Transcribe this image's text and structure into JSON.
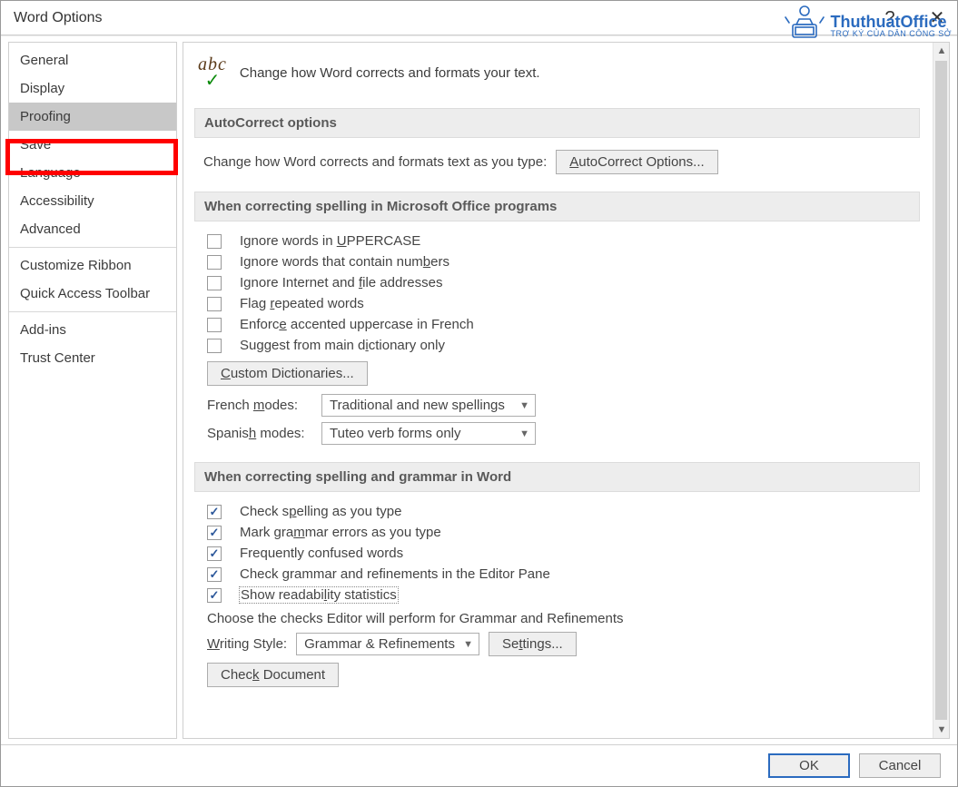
{
  "title": "Word Options",
  "sidebar": {
    "items": [
      {
        "label": "General"
      },
      {
        "label": "Display"
      },
      {
        "label": "Proofing",
        "selected": true
      },
      {
        "label": "Save"
      },
      {
        "label": "Language"
      },
      {
        "label": "Accessibility"
      },
      {
        "label": "Advanced"
      }
    ],
    "group2": [
      {
        "label": "Customize Ribbon"
      },
      {
        "label": "Quick Access Toolbar"
      }
    ],
    "group3": [
      {
        "label": "Add-ins"
      },
      {
        "label": "Trust Center"
      }
    ]
  },
  "header": {
    "text": "Change how Word corrects and formats your text."
  },
  "sections": {
    "autocorrect": {
      "title": "AutoCorrect options",
      "desc": "Change how Word corrects and formats text as you type:",
      "button": "AutoCorrect Options..."
    },
    "office": {
      "title": "When correcting spelling in Microsoft Office programs",
      "checks": [
        "Ignore words in UPPERCASE",
        "Ignore words that contain numbers",
        "Ignore Internet and file addresses",
        "Flag repeated words",
        "Enforce accented uppercase in French",
        "Suggest from main dictionary only"
      ],
      "custom_btn": "Custom Dictionaries...",
      "french_label": "French modes:",
      "french_value": "Traditional and new spellings",
      "spanish_label": "Spanish modes:",
      "spanish_value": "Tuteo verb forms only"
    },
    "word": {
      "title": "When correcting spelling and grammar in Word",
      "checks": [
        "Check spelling as you type",
        "Mark grammar errors as you type",
        "Frequently confused words",
        "Check grammar and refinements in the Editor Pane",
        "Show readability statistics"
      ],
      "desc": "Choose the checks Editor will perform for Grammar and Refinements",
      "writing_label": "Writing Style:",
      "writing_value": "Grammar & Refinements",
      "settings_btn": "Settings...",
      "checkdoc_btn": "Check Document"
    }
  },
  "footer": {
    "ok": "OK",
    "cancel": "Cancel"
  },
  "watermark": {
    "brand": "ThuthuatOffice",
    "tag": "TRỢ KÝ CỦA DÂN CÔNG SỞ"
  }
}
